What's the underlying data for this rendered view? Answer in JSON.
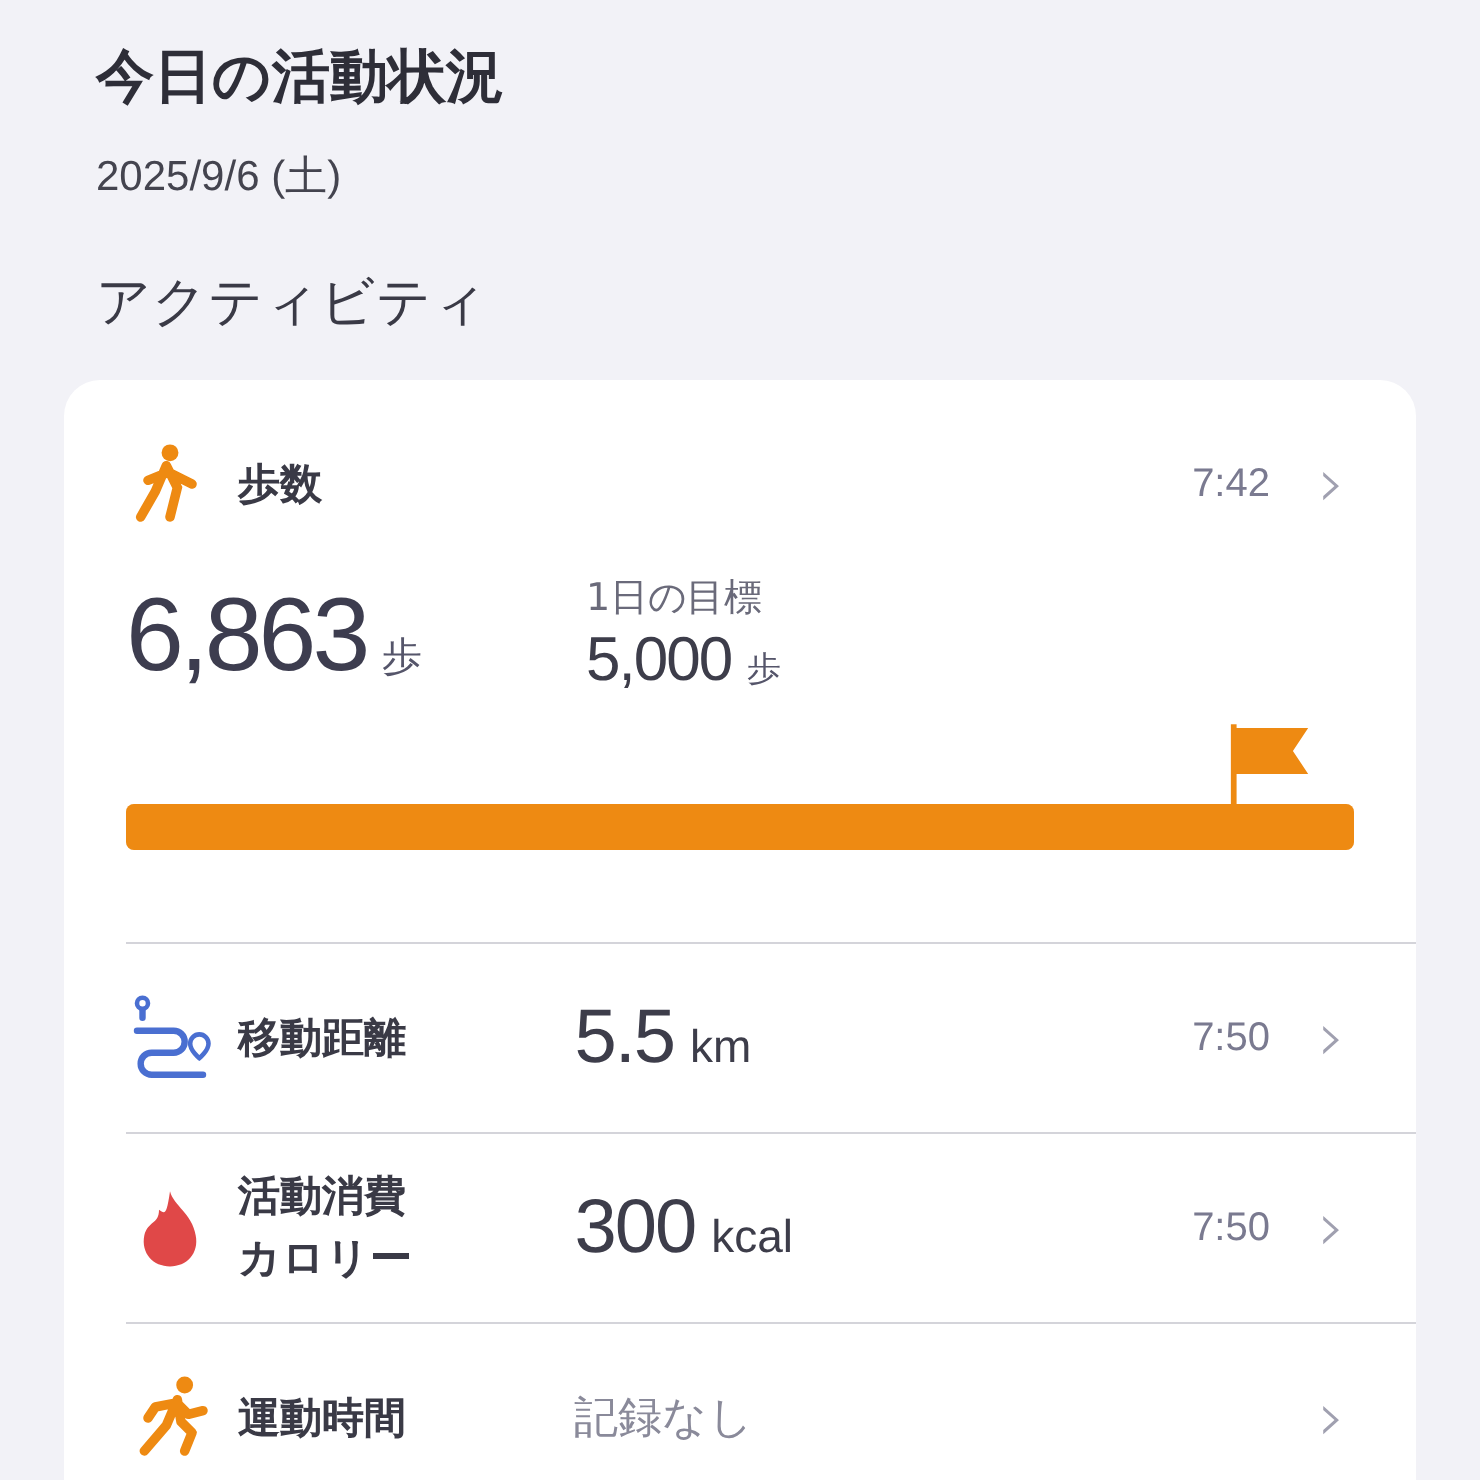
{
  "title": "今日の活動状況",
  "date": "2025/9/6 (土)",
  "section_title": "アクティビティ",
  "steps": {
    "label": "歩数",
    "time": "7:42",
    "chevron": "›",
    "value": "6,863",
    "unit": "歩",
    "goal_label": "1日の目標",
    "goal_value": "5,000",
    "goal_unit": "歩",
    "level": 1
  },
  "metrics": [
    {
      "kind": "route",
      "name": "移動距離",
      "value": "5.5",
      "unit": "km",
      "time": "7:50",
      "chevron": "›"
    },
    {
      "kind": "flame",
      "name": "活動消費カロリー",
      "value": "300",
      "unit": "kcal",
      "time": "7:50",
      "chevron": "›"
    },
    {
      "kind": "run",
      "name": "運動時間",
      "empty_text": "記録なし",
      "chevron": "›"
    }
  ]
}
